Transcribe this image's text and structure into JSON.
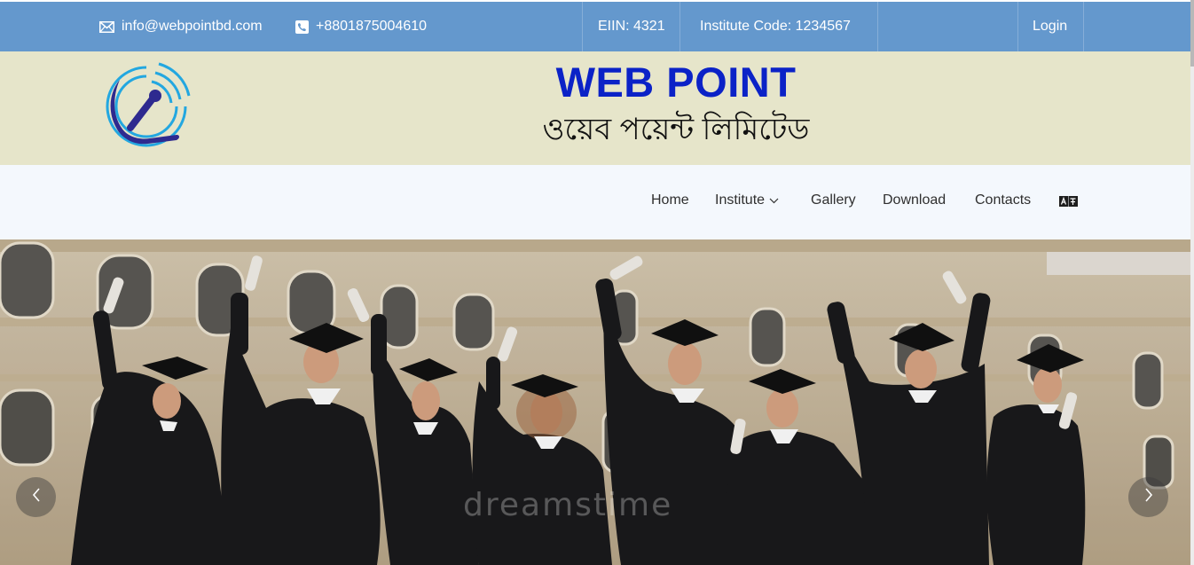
{
  "topbar": {
    "email": "info@webpointbd.com",
    "phone": "+8801875004610",
    "eiin": "EIIN: 4321",
    "institute_code": "Institute Code: 1234567",
    "login_label": "Login",
    "email_icon": "envelope-icon",
    "phone_icon": "phone-icon",
    "background": "#6498cd"
  },
  "brand": {
    "title": "WEB POINT",
    "subtitle": "ওয়েব পয়েন্ট লিমিটেড",
    "logo_icon": "webpoint-logo",
    "title_color": "#0b22c7",
    "background": "#e6e5ca"
  },
  "nav": {
    "items": [
      {
        "label": "Home"
      },
      {
        "label": "Institute",
        "icon": "chevron-down-icon"
      },
      {
        "label": "Gallery"
      },
      {
        "label": "Download"
      },
      {
        "label": "Contacts"
      }
    ],
    "language_icon": "language-toggle-icon"
  },
  "hero": {
    "watermark": "dreamstime",
    "prev_icon": "chevron-left-icon",
    "next_icon": "chevron-right-icon"
  }
}
